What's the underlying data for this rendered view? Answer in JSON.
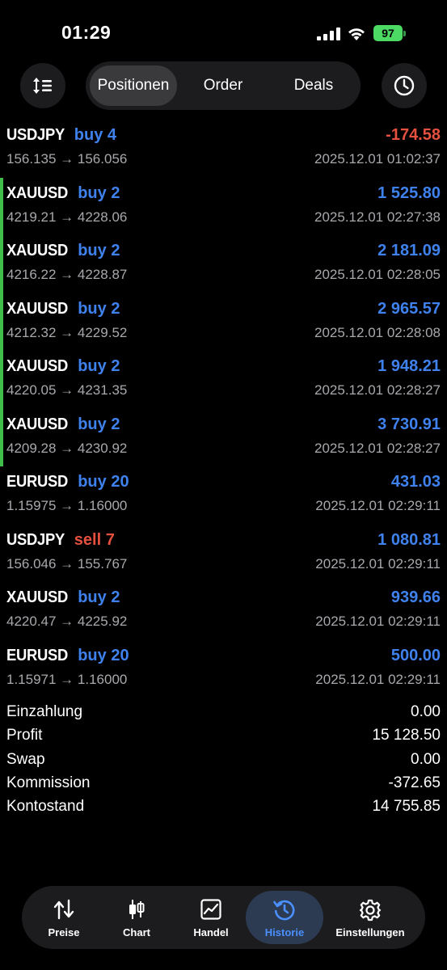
{
  "status_bar": {
    "time": "01:29",
    "battery": "97"
  },
  "segments": [
    "Positionen",
    "Order",
    "Deals"
  ],
  "active_segment": 0,
  "rows": [
    {
      "symbol": "USDJPY",
      "side": "buy",
      "lots": "4",
      "prices": "156.135 → 156.056",
      "profit": "-174.58",
      "negative": true,
      "time": "2025.12.01 01:02:37",
      "highlight": false
    },
    {
      "symbol": "XAUUSD",
      "side": "buy",
      "lots": "2",
      "prices": "4219.21 → 4228.06",
      "profit": "1 525.80",
      "negative": false,
      "time": "2025.12.01 02:27:38",
      "highlight": true
    },
    {
      "symbol": "XAUUSD",
      "side": "buy",
      "lots": "2",
      "prices": "4216.22 → 4228.87",
      "profit": "2 181.09",
      "negative": false,
      "time": "2025.12.01 02:28:05",
      "highlight": true
    },
    {
      "symbol": "XAUUSD",
      "side": "buy",
      "lots": "2",
      "prices": "4212.32 → 4229.52",
      "profit": "2 965.57",
      "negative": false,
      "time": "2025.12.01 02:28:08",
      "highlight": true
    },
    {
      "symbol": "XAUUSD",
      "side": "buy",
      "lots": "2",
      "prices": "4220.05 → 4231.35",
      "profit": "1 948.21",
      "negative": false,
      "time": "2025.12.01 02:28:27",
      "highlight": true
    },
    {
      "symbol": "XAUUSD",
      "side": "buy",
      "lots": "2",
      "prices": "4209.28 → 4230.92",
      "profit": "3 730.91",
      "negative": false,
      "time": "2025.12.01 02:28:27",
      "highlight": true
    },
    {
      "symbol": "EURUSD",
      "side": "buy",
      "lots": "20",
      "prices": "1.15975 → 1.16000",
      "profit": "431.03",
      "negative": false,
      "time": "2025.12.01 02:29:11",
      "highlight": false
    },
    {
      "symbol": "USDJPY",
      "side": "sell",
      "lots": "7",
      "prices": "156.046 → 155.767",
      "profit": "1 080.81",
      "negative": false,
      "time": "2025.12.01 02:29:11",
      "highlight": false
    },
    {
      "symbol": "XAUUSD",
      "side": "buy",
      "lots": "2",
      "prices": "4220.47 → 4225.92",
      "profit": "939.66",
      "negative": false,
      "time": "2025.12.01 02:29:11",
      "highlight": false
    },
    {
      "symbol": "EURUSD",
      "side": "buy",
      "lots": "20",
      "prices": "1.15971 → 1.16000",
      "profit": "500.00",
      "negative": false,
      "time": "2025.12.01 02:29:11",
      "highlight": false
    }
  ],
  "summary": [
    {
      "label": "Einzahlung",
      "value": "0.00"
    },
    {
      "label": "Profit",
      "value": "15 128.50"
    },
    {
      "label": "Swap",
      "value": "0.00"
    },
    {
      "label": "Kommission",
      "value": "-372.65"
    },
    {
      "label": "Kontostand",
      "value": "14 755.85"
    }
  ],
  "tabs": [
    {
      "label": "Preise",
      "icon": "arrows-up-down-icon"
    },
    {
      "label": "Chart",
      "icon": "candlestick-icon"
    },
    {
      "label": "Handel",
      "icon": "trade-chart-icon"
    },
    {
      "label": "Historie",
      "icon": "history-icon"
    },
    {
      "label": "Einstellungen",
      "icon": "gear-icon"
    }
  ],
  "active_tab": 3,
  "colors": {
    "buy": "#3f82ee",
    "sell": "#e5503f",
    "highlight": "#3fbf4a",
    "battery": "#4cd964",
    "active_tab": "#4a90ff"
  }
}
